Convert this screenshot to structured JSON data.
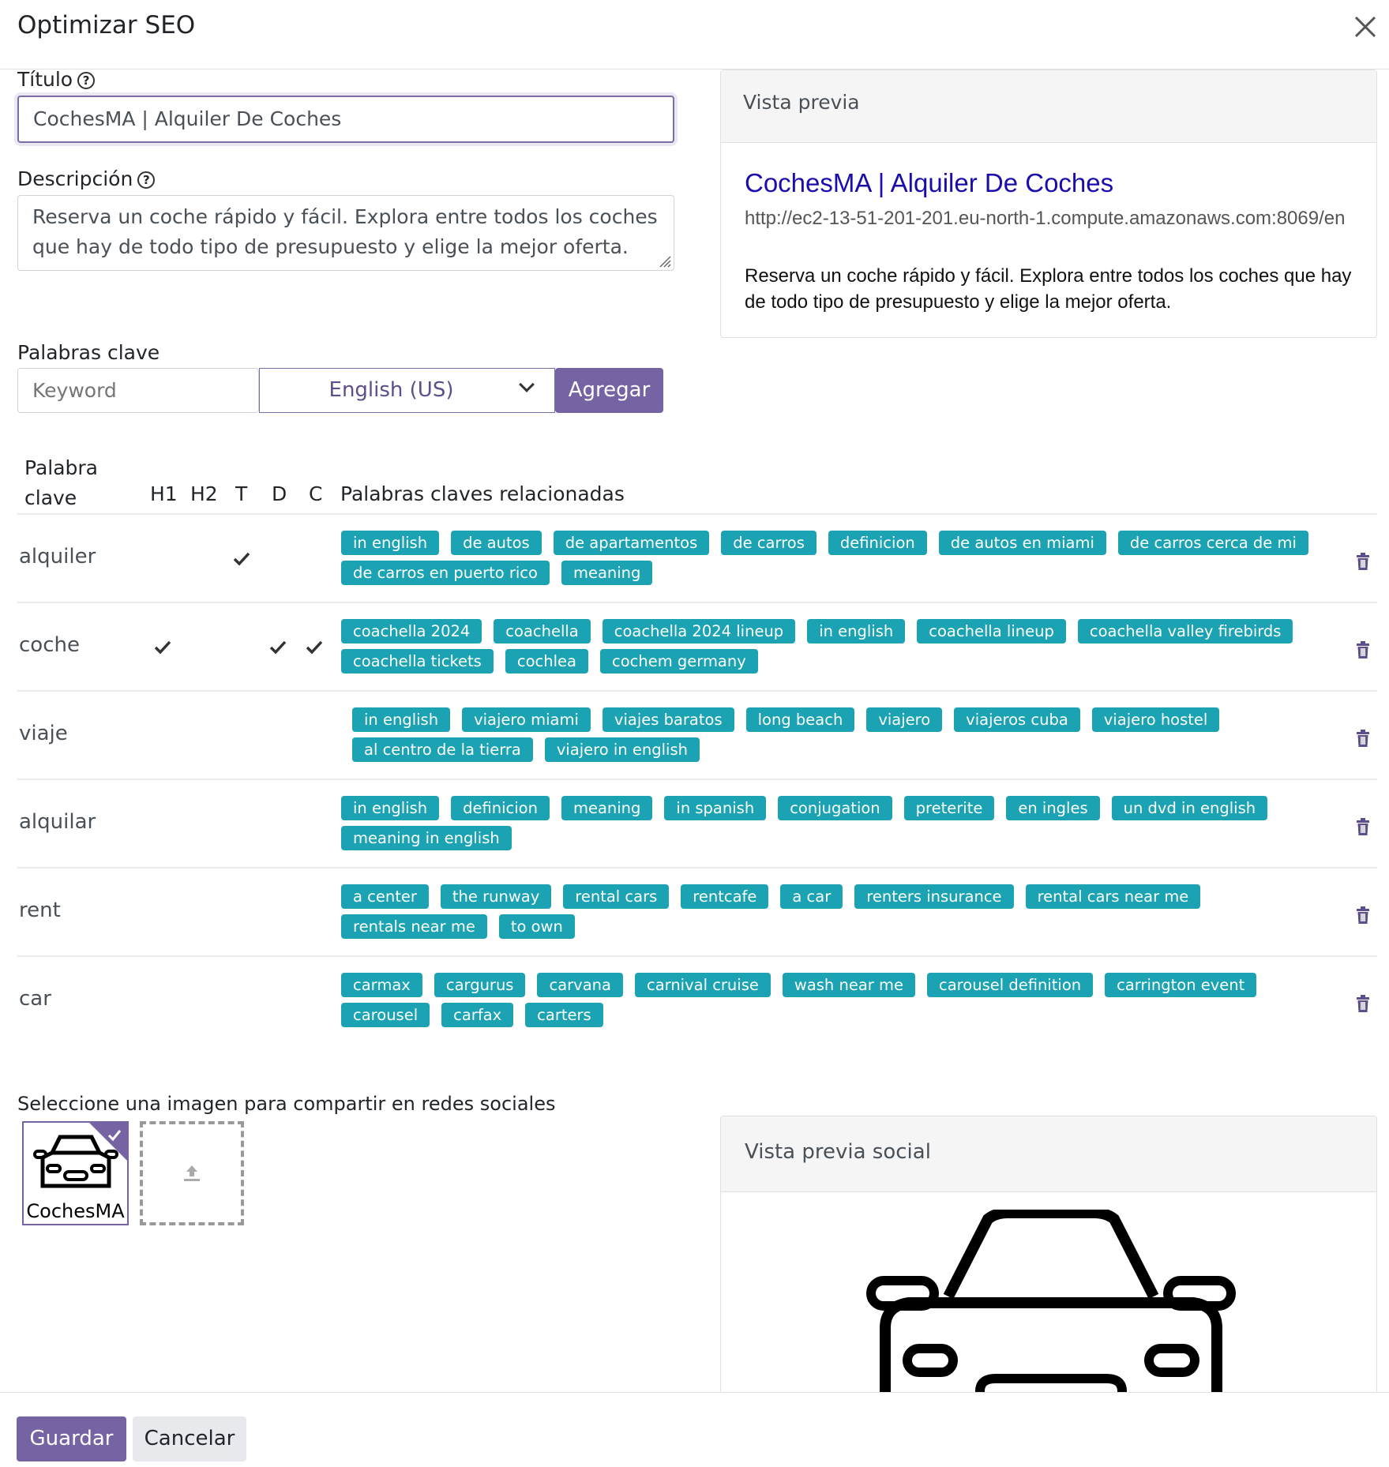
{
  "dialog": {
    "title": "Optimizar SEO"
  },
  "form": {
    "title_label": "Título",
    "title_value": "CochesMA | Alquiler De Coches",
    "description_label": "Descripción",
    "description_value": "Reserva un coche rápido y fácil. Explora entre todos los coches que hay de todo tipo de presupuesto y elige la mejor oferta.",
    "keywords_label": "Palabras clave",
    "keyword_placeholder": "Keyword",
    "language_selected": "English (US)",
    "add_button": "Agregar"
  },
  "preview": {
    "heading": "Vista previa",
    "title": "CochesMA | Alquiler De Coches",
    "url": "http://ec2-13-51-201-201.eu-north-1.compute.amazonaws.com:8069/en",
    "description": "Reserva un coche rápido y fácil. Explora entre todos los coches que hay de todo tipo de presupuesto y elige la mejor oferta."
  },
  "table": {
    "headers": {
      "keyword_line1": "Palabra",
      "keyword_line2": "clave",
      "h1": "H1",
      "h2": "H2",
      "t": "T",
      "d": "D",
      "c": "C",
      "related": "Palabras claves relacionadas"
    },
    "rows": [
      {
        "keyword": "alquiler",
        "h1": false,
        "h2": false,
        "t": true,
        "d": false,
        "c": false,
        "related": [
          "in english",
          "de autos",
          "de apartamentos",
          "de carros",
          "definicion",
          "de autos en miami",
          "de carros cerca de mi",
          "de carros en puerto rico",
          "meaning"
        ]
      },
      {
        "keyword": "coche",
        "h1": true,
        "h2": false,
        "t": false,
        "d": true,
        "c": true,
        "related": [
          "coachella 2024",
          "coachella",
          "coachella 2024 lineup",
          "in english",
          "coachella lineup",
          "coachella valley firebirds",
          "coachella tickets",
          "cochlea",
          "cochem germany"
        ]
      },
      {
        "keyword": "viaje",
        "h1": false,
        "h2": false,
        "t": false,
        "d": false,
        "c": false,
        "related": [
          "in english",
          "viajero miami",
          "viajes baratos",
          "long beach",
          "viajero",
          "viajeros cuba",
          "viajero hostel",
          "al centro de la tierra",
          "viajero in english"
        ]
      },
      {
        "keyword": "alquilar",
        "h1": false,
        "h2": false,
        "t": false,
        "d": false,
        "c": false,
        "related": [
          "in english",
          "definicion",
          "meaning",
          "in spanish",
          "conjugation",
          "preterite",
          "en ingles",
          "un dvd in english",
          "meaning in english"
        ]
      },
      {
        "keyword": "rent",
        "h1": false,
        "h2": false,
        "t": false,
        "d": false,
        "c": false,
        "related": [
          "a center",
          "the runway",
          "rental cars",
          "rentcafe",
          "a car",
          "renters insurance",
          "rental cars near me",
          "rentals near me",
          "to own"
        ]
      },
      {
        "keyword": "car",
        "h1": false,
        "h2": false,
        "t": false,
        "d": false,
        "c": false,
        "related": [
          "carmax",
          "cargurus",
          "carvana",
          "carnival cruise",
          "wash near me",
          "carousel definition",
          "carrington event",
          "carousel",
          "carfax",
          "carters"
        ]
      }
    ]
  },
  "social": {
    "select_label": "Seleccione una imagen para compartir en redes sociales",
    "thumb_caption": "CochesMA",
    "preview_heading": "Vista previa social"
  },
  "footer": {
    "save": "Guardar",
    "cancel": "Cancelar"
  },
  "colors": {
    "accent": "#7563a3",
    "tag": "#1ba3b3",
    "link": "#1a0dab"
  },
  "icons": {
    "close": "close-icon",
    "help": "help-icon",
    "check": "check-icon",
    "trash": "trash-icon",
    "upload": "upload-icon",
    "chevron": "chevron-down-icon"
  }
}
